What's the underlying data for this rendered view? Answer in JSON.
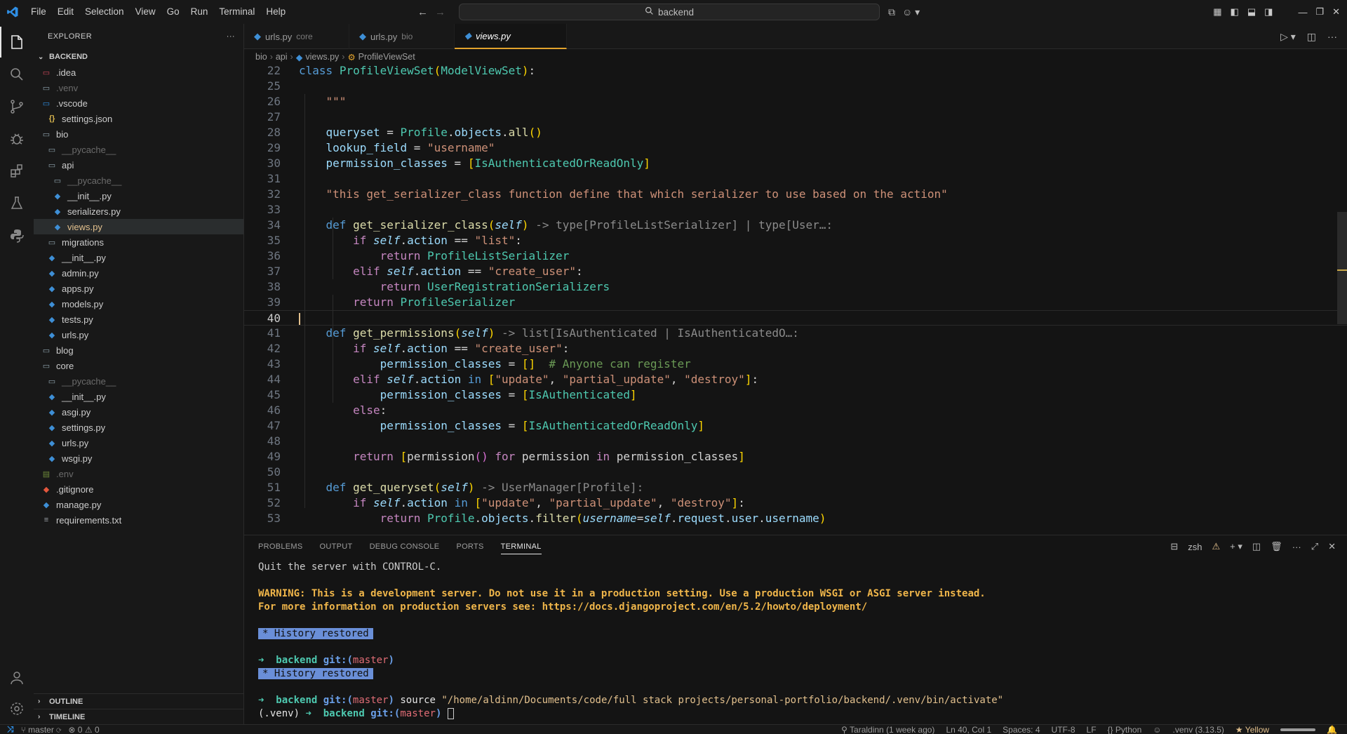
{
  "titlebar": {
    "menu": [
      "File",
      "Edit",
      "Selection",
      "View",
      "Go",
      "Run",
      "Terminal",
      "Help"
    ],
    "search_text": "backend"
  },
  "sidebar": {
    "title": "EXPLORER",
    "root": "BACKEND",
    "tree": [
      {
        "label": ".idea",
        "indent": 1,
        "icon": "idea-folder-icon"
      },
      {
        "label": ".venv",
        "indent": 1,
        "icon": "folder-icon",
        "dim": true
      },
      {
        "label": ".vscode",
        "indent": 1,
        "icon": "vscode-folder-icon"
      },
      {
        "label": "settings.json",
        "indent": 2,
        "icon": "json-file-icon"
      },
      {
        "label": "bio",
        "indent": 1,
        "icon": "folder-icon"
      },
      {
        "label": "__pycache__",
        "indent": 2,
        "icon": "folder-icon",
        "dim": true
      },
      {
        "label": "api",
        "indent": 2,
        "icon": "folder-icon"
      },
      {
        "label": "__pycache__",
        "indent": 3,
        "icon": "folder-icon",
        "dim": true
      },
      {
        "label": "__init__.py",
        "indent": 3,
        "icon": "python-file-icon"
      },
      {
        "label": "serializers.py",
        "indent": 3,
        "icon": "python-file-icon"
      },
      {
        "label": "views.py",
        "indent": 3,
        "icon": "python-file-icon",
        "selected": true
      },
      {
        "label": "migrations",
        "indent": 2,
        "icon": "folder-icon"
      },
      {
        "label": "__init__.py",
        "indent": 2,
        "icon": "python-file-icon"
      },
      {
        "label": "admin.py",
        "indent": 2,
        "icon": "python-file-icon"
      },
      {
        "label": "apps.py",
        "indent": 2,
        "icon": "python-file-icon"
      },
      {
        "label": "models.py",
        "indent": 2,
        "icon": "python-file-icon"
      },
      {
        "label": "tests.py",
        "indent": 2,
        "icon": "python-file-icon"
      },
      {
        "label": "urls.py",
        "indent": 2,
        "icon": "python-file-icon"
      },
      {
        "label": "blog",
        "indent": 1,
        "icon": "folder-icon"
      },
      {
        "label": "core",
        "indent": 1,
        "icon": "folder-icon"
      },
      {
        "label": "__pycache__",
        "indent": 2,
        "icon": "folder-icon",
        "dim": true
      },
      {
        "label": "__init__.py",
        "indent": 2,
        "icon": "python-file-icon"
      },
      {
        "label": "asgi.py",
        "indent": 2,
        "icon": "python-file-icon"
      },
      {
        "label": "settings.py",
        "indent": 2,
        "icon": "python-file-icon"
      },
      {
        "label": "urls.py",
        "indent": 2,
        "icon": "python-file-icon"
      },
      {
        "label": "wsgi.py",
        "indent": 2,
        "icon": "python-file-icon"
      },
      {
        "label": ".env",
        "indent": 1,
        "icon": "env-file-icon",
        "dim": true
      },
      {
        "label": ".gitignore",
        "indent": 1,
        "icon": "git-file-icon"
      },
      {
        "label": "manage.py",
        "indent": 1,
        "icon": "python-file-icon"
      },
      {
        "label": "requirements.txt",
        "indent": 1,
        "icon": "text-file-icon"
      }
    ],
    "outline_label": "OUTLINE",
    "timeline_label": "TIMELINE"
  },
  "tabs": [
    {
      "label": "urls.py",
      "desc": "core",
      "active": false
    },
    {
      "label": "urls.py",
      "desc": "bio",
      "active": false
    },
    {
      "label": "views.py",
      "desc": "",
      "active": true
    }
  ],
  "breadcrumb": [
    "bio",
    "api",
    "views.py",
    "ProfileViewSet"
  ],
  "code_lines": [
    {
      "n": "22",
      "html": "<span class=\"kw2\">class</span> <span class=\"cls\">ProfileViewSet</span><span class=\"br1\">(</span><span class=\"cls\">ModelViewSet</span><span class=\"br1\">)</span>:"
    },
    {
      "n": "25",
      "html": ""
    },
    {
      "n": "26",
      "html": "    <span class=\"s\">\"\"\"</span>"
    },
    {
      "n": "27",
      "html": ""
    },
    {
      "n": "28",
      "html": "    <span class=\"var\">queryset</span> = <span class=\"cls\">Profile</span>.<span class=\"var\">objects</span>.<span class=\"fn\">all</span><span class=\"br1\">()</span>"
    },
    {
      "n": "29",
      "html": "    <span class=\"var\">lookup_field</span> = <span class=\"s\">\"username\"</span>"
    },
    {
      "n": "30",
      "html": "    <span class=\"var\">permission_classes</span> = <span class=\"br1\">[</span><span class=\"cls\">IsAuthenticatedOrReadOnly</span><span class=\"br1\">]</span>"
    },
    {
      "n": "31",
      "html": ""
    },
    {
      "n": "32",
      "html": "    <span class=\"s\">\"this get_serializer_class function define that which serializer to use based on the action\"</span>"
    },
    {
      "n": "33",
      "html": ""
    },
    {
      "n": "34",
      "html": "    <span class=\"kw2\">def</span> <span class=\"fn\">get_serializer_class</span><span class=\"br1\">(</span><span class=\"self\">self</span><span class=\"br1\">)</span> <span class=\"hint\">-&gt; type[ProfileListSerializer] | type[User…:</span>"
    },
    {
      "n": "35",
      "html": "        <span class=\"kw\">if</span> <span class=\"self\">self</span>.<span class=\"var\">action</span> == <span class=\"s\">\"list\"</span>:"
    },
    {
      "n": "36",
      "html": "            <span class=\"kw\">return</span> <span class=\"cls\">ProfileListSerializer</span>"
    },
    {
      "n": "37",
      "html": "        <span class=\"kw\">elif</span> <span class=\"self\">self</span>.<span class=\"var\">action</span> == <span class=\"s\">\"create_user\"</span>:"
    },
    {
      "n": "38",
      "html": "            <span class=\"kw\">return</span> <span class=\"cls\">UserRegistrationSerializers</span>"
    },
    {
      "n": "39",
      "html": "        <span class=\"kw\">return</span> <span class=\"cls\">ProfileSerializer</span>"
    },
    {
      "n": "40",
      "html": "",
      "current": true
    },
    {
      "n": "41",
      "html": "    <span class=\"kw2\">def</span> <span class=\"fn\">get_permissions</span><span class=\"br1\">(</span><span class=\"self\">self</span><span class=\"br1\">)</span> <span class=\"hint\">-&gt; list[IsAuthenticated | IsAuthenticatedO…:</span>"
    },
    {
      "n": "42",
      "html": "        <span class=\"kw\">if</span> <span class=\"self\">self</span>.<span class=\"var\">action</span> == <span class=\"s\">\"create_user\"</span>:"
    },
    {
      "n": "43",
      "html": "            <span class=\"var\">permission_classes</span> = <span class=\"br1\">[]</span>  <span class=\"cm\"># Anyone can register</span>"
    },
    {
      "n": "44",
      "html": "        <span class=\"kw\">elif</span> <span class=\"self\">self</span>.<span class=\"var\">action</span> <span class=\"kw2\">in</span> <span class=\"br1\">[</span><span class=\"s\">\"update\"</span>, <span class=\"s\">\"partial_update\"</span>, <span class=\"s\">\"destroy\"</span><span class=\"br1\">]</span>:"
    },
    {
      "n": "45",
      "html": "            <span class=\"var\">permission_classes</span> = <span class=\"br1\">[</span><span class=\"cls\">IsAuthenticated</span><span class=\"br1\">]</span>"
    },
    {
      "n": "46",
      "html": "        <span class=\"kw\">else</span>:"
    },
    {
      "n": "47",
      "html": "            <span class=\"var\">permission_classes</span> = <span class=\"br1\">[</span><span class=\"cls\">IsAuthenticatedOrReadOnly</span><span class=\"br1\">]</span>"
    },
    {
      "n": "48",
      "html": ""
    },
    {
      "n": "49",
      "html": "        <span class=\"kw\">return</span> <span class=\"br1\">[</span><span class=\"plain\">permission</span><span class=\"br2\">()</span> <span class=\"kw\">for</span> <span class=\"plain\">permission</span> <span class=\"kw\">in</span> <span class=\"plain\">permission_classes</span><span class=\"br1\">]</span>"
    },
    {
      "n": "50",
      "html": ""
    },
    {
      "n": "51",
      "html": "    <span class=\"kw2\">def</span> <span class=\"fn\">get_queryset</span><span class=\"br1\">(</span><span class=\"self\">self</span><span class=\"br1\">)</span> <span class=\"hint\">-&gt; UserManager[Profile]:</span>"
    },
    {
      "n": "52",
      "html": "        <span class=\"kw\">if</span> <span class=\"self\">self</span>.<span class=\"var\">action</span> <span class=\"kw2\">in</span> <span class=\"br1\">[</span><span class=\"s\">\"update\"</span>, <span class=\"s\">\"partial_update\"</span>, <span class=\"s\">\"destroy\"</span><span class=\"br1\">]</span>:"
    },
    {
      "n": "53",
      "html": "            <span class=\"kw\">return</span> <span class=\"cls\">Profile</span>.<span class=\"var\">objects</span>.<span class=\"fn\">filter</span><span class=\"br1\">(</span><span class=\"self\">username</span>=<span class=\"self\">self</span>.<span class=\"var\">request</span>.<span class=\"var\">user</span>.<span class=\"var\">username</span><span class=\"br1\">)</span>"
    }
  ],
  "panel": {
    "tabs": [
      "PROBLEMS",
      "OUTPUT",
      "DEBUG CONSOLE",
      "PORTS",
      "TERMINAL"
    ],
    "active_tab": "TERMINAL",
    "shell_label": "zsh"
  },
  "terminal": {
    "quit_line": "Quit the server with CONTROL-C.",
    "warning_line": "WARNING: This is a development server. Do not use it in a production setting. Use a production WSGI or ASGI server instead.",
    "info_line": "For more information on production servers see: https://docs.djangoproject.com/en/5.2/howto/deployment/",
    "history_badge": "History restored",
    "prompt_arrow": "➜",
    "prompt_dir": "backend",
    "prompt_git": "git:(",
    "prompt_branch": "master",
    "prompt_close": ")",
    "source_cmd": "source",
    "source_path": "\"/home/aldinn/Documents/code/full stack projects/personal-portfolio/backend/.venv/bin/activate\"",
    "venv_prefix": "(.venv)"
  },
  "statusbar": {
    "branch": "master",
    "errors": "0",
    "warnings": "0",
    "blame": "Taraldinn (1 week ago)",
    "position": "Ln 40, Col 1",
    "spaces": "Spaces: 4",
    "encoding": "UTF-8",
    "eol": "LF",
    "language": "Python",
    "interpreter": ".venv (3.13.5)",
    "theme": "Yellow"
  },
  "colors": {
    "accent_tab": "#e2a32d",
    "background": "#141414",
    "sidebar": "#181818"
  }
}
